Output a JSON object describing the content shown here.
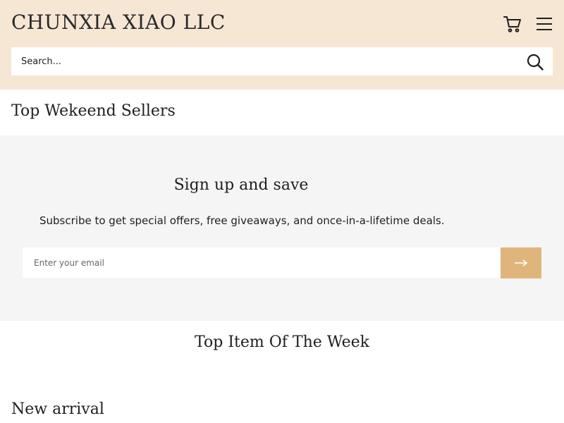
{
  "header": {
    "brand": "CHUNXIA XIAO LLC",
    "background": "#f6e6d4",
    "cart_icon": "cart-icon",
    "menu_icon": "hamburger-menu-icon"
  },
  "search": {
    "placeholder": "Search...",
    "icon": "search-icon"
  },
  "sections": {
    "top_weekend_sellers": "Top Wekeend Sellers",
    "top_item_of_week": "Top Item Of The Week",
    "new_arrival": "New arrival"
  },
  "newsletter": {
    "title": "Sign up and save",
    "subtitle": "Subscribe to get special offers, free giveaways, and once-in-a-lifetime deals.",
    "email_placeholder": "Enter your email",
    "submit_icon": "arrow-right-icon",
    "accent_color": "#e0b57c",
    "background": "#f5f5f5"
  }
}
